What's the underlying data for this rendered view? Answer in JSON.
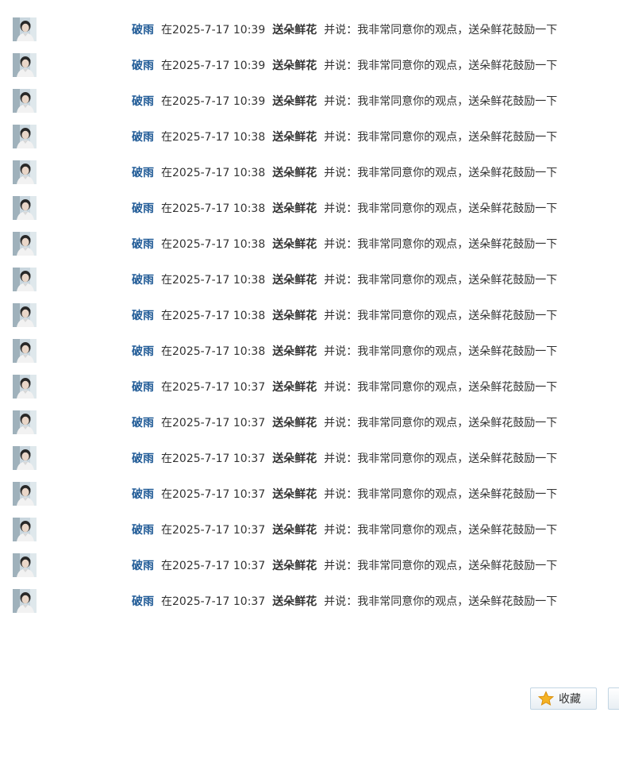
{
  "feed": {
    "items": [
      {
        "user": "破雨",
        "time": "在2025-7-17 10:39",
        "action": "送朵鲜花",
        "comment": "并说：我非常同意你的观点，送朵鲜花鼓励一下"
      },
      {
        "user": "破雨",
        "time": "在2025-7-17 10:39",
        "action": "送朵鲜花",
        "comment": "并说：我非常同意你的观点，送朵鲜花鼓励一下"
      },
      {
        "user": "破雨",
        "time": "在2025-7-17 10:39",
        "action": "送朵鲜花",
        "comment": "并说：我非常同意你的观点，送朵鲜花鼓励一下"
      },
      {
        "user": "破雨",
        "time": "在2025-7-17 10:38",
        "action": "送朵鲜花",
        "comment": "并说：我非常同意你的观点，送朵鲜花鼓励一下"
      },
      {
        "user": "破雨",
        "time": "在2025-7-17 10:38",
        "action": "送朵鲜花",
        "comment": "并说：我非常同意你的观点，送朵鲜花鼓励一下"
      },
      {
        "user": "破雨",
        "time": "在2025-7-17 10:38",
        "action": "送朵鲜花",
        "comment": "并说：我非常同意你的观点，送朵鲜花鼓励一下"
      },
      {
        "user": "破雨",
        "time": "在2025-7-17 10:38",
        "action": "送朵鲜花",
        "comment": "并说：我非常同意你的观点，送朵鲜花鼓励一下"
      },
      {
        "user": "破雨",
        "time": "在2025-7-17 10:38",
        "action": "送朵鲜花",
        "comment": "并说：我非常同意你的观点，送朵鲜花鼓励一下"
      },
      {
        "user": "破雨",
        "time": "在2025-7-17 10:38",
        "action": "送朵鲜花",
        "comment": "并说：我非常同意你的观点，送朵鲜花鼓励一下"
      },
      {
        "user": "破雨",
        "time": "在2025-7-17 10:38",
        "action": "送朵鲜花",
        "comment": "并说：我非常同意你的观点，送朵鲜花鼓励一下"
      },
      {
        "user": "破雨",
        "time": "在2025-7-17 10:37",
        "action": "送朵鲜花",
        "comment": "并说：我非常同意你的观点，送朵鲜花鼓励一下"
      },
      {
        "user": "破雨",
        "time": "在2025-7-17 10:37",
        "action": "送朵鲜花",
        "comment": "并说：我非常同意你的观点，送朵鲜花鼓励一下"
      },
      {
        "user": "破雨",
        "time": "在2025-7-17 10:37",
        "action": "送朵鲜花",
        "comment": "并说：我非常同意你的观点，送朵鲜花鼓励一下"
      },
      {
        "user": "破雨",
        "time": "在2025-7-17 10:37",
        "action": "送朵鲜花",
        "comment": "并说：我非常同意你的观点，送朵鲜花鼓励一下"
      },
      {
        "user": "破雨",
        "time": "在2025-7-17 10:37",
        "action": "送朵鲜花",
        "comment": "并说：我非常同意你的观点，送朵鲜花鼓励一下"
      },
      {
        "user": "破雨",
        "time": "在2025-7-17 10:37",
        "action": "送朵鲜花",
        "comment": "并说：我非常同意你的观点，送朵鲜花鼓励一下"
      },
      {
        "user": "破雨",
        "time": "在2025-7-17 10:37",
        "action": "送朵鲜花",
        "comment": "并说：我非常同意你的观点，送朵鲜花鼓励一下"
      }
    ]
  },
  "footer": {
    "favorite_label": "收藏",
    "favorite_icon": "star-icon"
  },
  "colors": {
    "username": "#1f5a96",
    "text": "#333333",
    "button_border": "#c2d5e3",
    "star": "#f5a623"
  }
}
